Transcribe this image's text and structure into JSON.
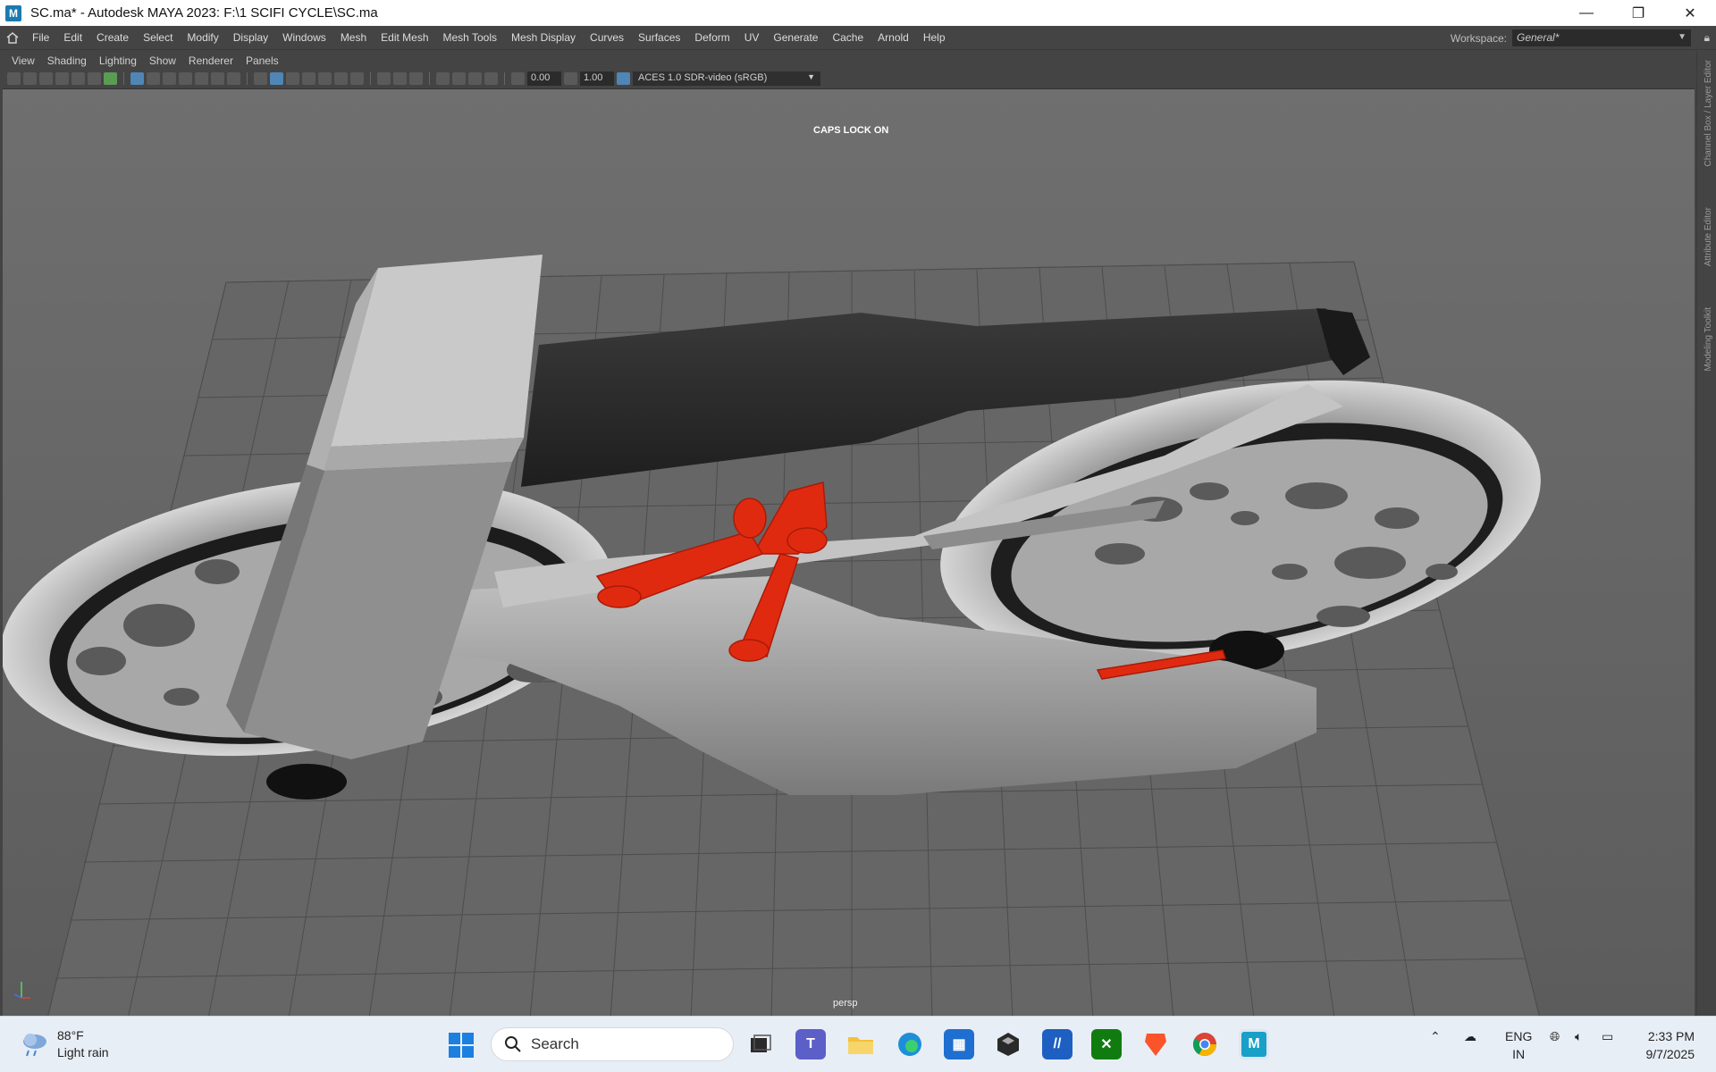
{
  "window": {
    "title": "SC.ma* - Autodesk MAYA 2023: F:\\1 SCIFI CYCLE\\SC.ma",
    "app_icon_letter": "M",
    "controls": {
      "minimize": "—",
      "restore": "❐",
      "close": "✕"
    }
  },
  "menubar": {
    "items": [
      "File",
      "Edit",
      "Create",
      "Select",
      "Modify",
      "Display",
      "Windows",
      "Mesh",
      "Edit Mesh",
      "Mesh Tools",
      "Mesh Display",
      "Curves",
      "Surfaces",
      "Deform",
      "UV",
      "Generate",
      "Cache",
      "Arnold",
      "Help"
    ],
    "workspace_label": "Workspace:",
    "workspace_value": "General*"
  },
  "panel_menu": {
    "items": [
      "View",
      "Shading",
      "Lighting",
      "Show",
      "Renderer",
      "Panels"
    ]
  },
  "toolbar": {
    "exposure_value": "0.00",
    "gamma_value": "1.00",
    "color_space": "ACES 1.0 SDR-video (sRGB)"
  },
  "viewport": {
    "caps_lock_text": "CAPS LOCK ON",
    "camera_label": "persp",
    "colors": {
      "background_top": "#6f6f6f",
      "grid": "#4f4f4f",
      "model_light": "#b9b9b9",
      "model_dark": "#2a2a2a",
      "selected": "#e02a10"
    }
  },
  "side_tabs": [
    "Channel Box / Layer Editor",
    "Attribute Editor",
    "Modeling Toolkit"
  ],
  "taskbar": {
    "weather_temp": "88°F",
    "weather_desc": "Light rain",
    "search_placeholder": "Search",
    "lang_top": "ENG",
    "lang_bottom": "IN",
    "time": "2:33 PM",
    "date": "9/7/2025",
    "apps": [
      "task-view",
      "teams",
      "file-explorer",
      "edge",
      "store",
      "unity",
      "autodesk-app",
      "xbox",
      "brave",
      "chrome",
      "maya"
    ]
  }
}
